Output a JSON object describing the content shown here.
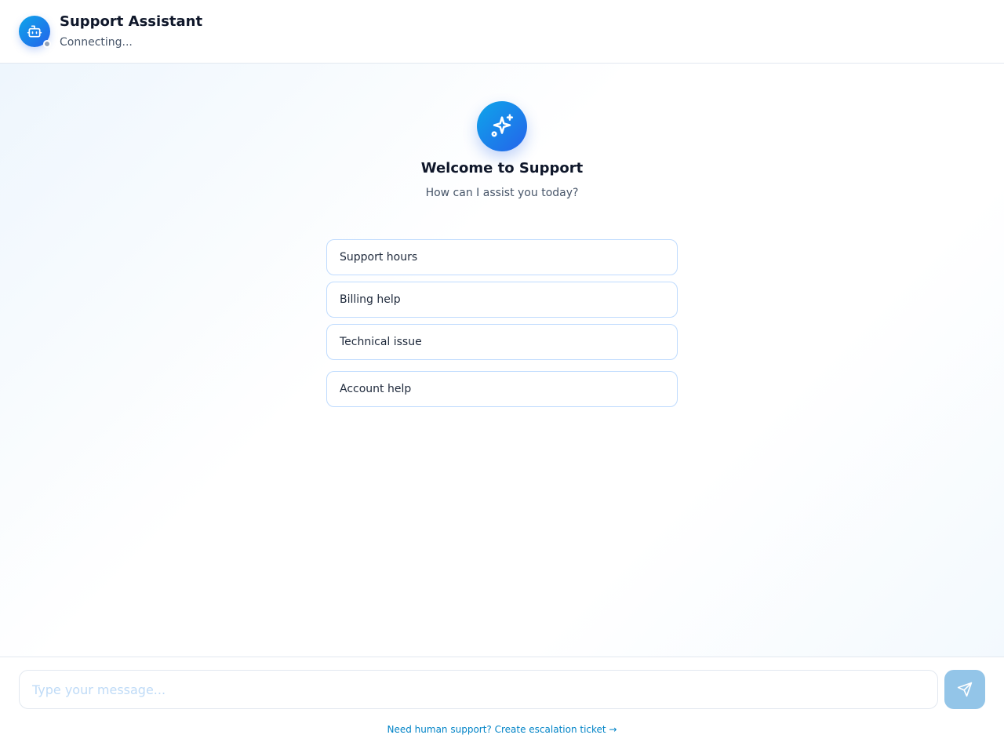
{
  "header": {
    "title": "Support Assistant",
    "status": "Connecting...",
    "avatar_icon": "bot-icon",
    "status_color": "#94a3b8"
  },
  "welcome": {
    "icon": "sparkles-icon",
    "title": "Welcome to Support",
    "subtitle": "How can I assist you today?"
  },
  "quick_replies": [
    {
      "label": "Support hours"
    },
    {
      "label": "Billing help"
    },
    {
      "label": "Technical issue"
    },
    {
      "label": "Account help"
    }
  ],
  "composer": {
    "placeholder": "Type your message...",
    "value": "",
    "send_icon": "send-icon"
  },
  "footer": {
    "escalation_link": "Need human support? Create escalation ticket →"
  },
  "colors": {
    "accent_start": "#0ea5e9",
    "accent_end": "#2563eb",
    "link": "#0284c7"
  }
}
